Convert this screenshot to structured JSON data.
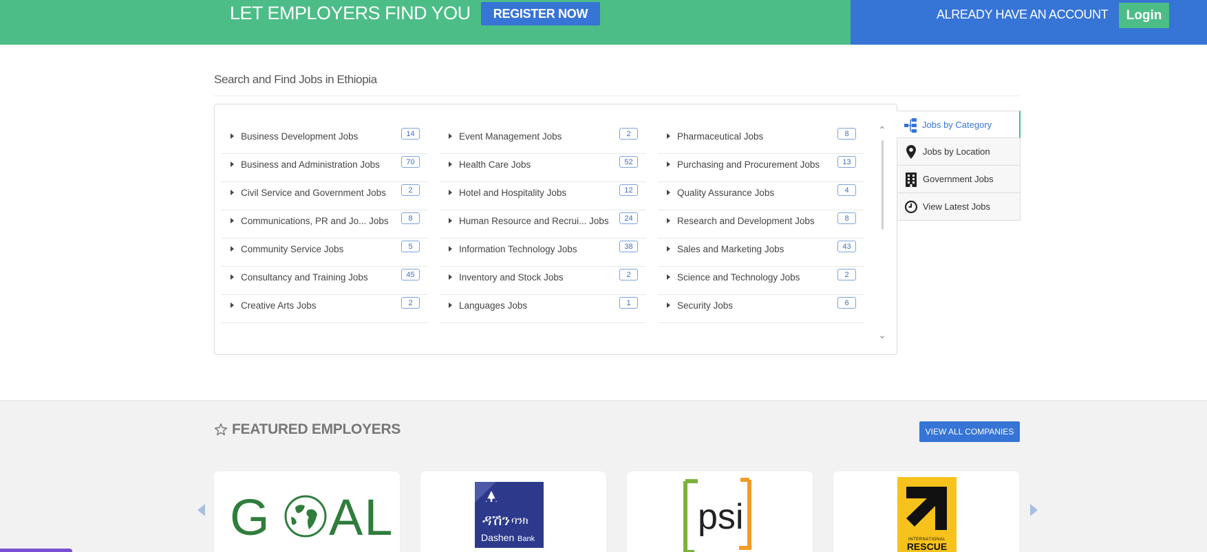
{
  "banner": {
    "headline": "LET EMPLOYERS FIND YOU",
    "register_label": "REGISTER NOW",
    "account_text": "ALREADY HAVE AN ACCOUNT",
    "login_label": "Login",
    "colors": {
      "green": "#4cbd87",
      "blue": "#3674d6"
    }
  },
  "search": {
    "title": "Search and Find Jobs in Ethiopia",
    "columns": [
      [
        {
          "label": "Business Development Jobs",
          "count": "14"
        },
        {
          "label": "Business and Administration Jobs",
          "count": "70"
        },
        {
          "label": "Civil Service and Government Jobs",
          "count": "2"
        },
        {
          "label": "Communications, PR and Jo... Jobs",
          "count": "8"
        },
        {
          "label": "Community Service Jobs",
          "count": "5"
        },
        {
          "label": "Consultancy and Training Jobs",
          "count": "45"
        },
        {
          "label": "Creative Arts Jobs",
          "count": "2"
        }
      ],
      [
        {
          "label": "Event Management Jobs",
          "count": "2"
        },
        {
          "label": "Health Care Jobs",
          "count": "52"
        },
        {
          "label": "Hotel and Hospitality Jobs",
          "count": "12"
        },
        {
          "label": "Human Resource and Recrui... Jobs",
          "count": "24"
        },
        {
          "label": "Information Technology Jobs",
          "count": "38"
        },
        {
          "label": "Inventory and Stock Jobs",
          "count": "2"
        },
        {
          "label": "Languages Jobs",
          "count": "1"
        }
      ],
      [
        {
          "label": "Pharmaceutical Jobs",
          "count": "8"
        },
        {
          "label": "Purchasing and Procurement Jobs",
          "count": "13"
        },
        {
          "label": "Quality Assurance Jobs",
          "count": "4"
        },
        {
          "label": "Research and Development Jobs",
          "count": "8"
        },
        {
          "label": "Sales and Marketing Jobs",
          "count": "43"
        },
        {
          "label": "Science and Technology Jobs",
          "count": "2"
        },
        {
          "label": "Security Jobs",
          "count": "6"
        }
      ]
    ]
  },
  "side_tabs": [
    {
      "label": "Jobs by Category",
      "icon": "category-tree-icon",
      "active": true
    },
    {
      "label": "Jobs by Location",
      "icon": "location-pin-icon",
      "active": false
    },
    {
      "label": "Government Jobs",
      "icon": "building-icon",
      "active": false
    },
    {
      "label": "View Latest Jobs",
      "icon": "clock-icon",
      "active": false
    }
  ],
  "featured": {
    "title": "FEATURED EMPLOYERS",
    "view_all_label": "VIEW ALL COMPANIES",
    "employers": [
      {
        "logo_text": "GOAL",
        "icon": "goal-logo"
      },
      {
        "logo_text": "Dashen Bank",
        "icon": "dashen-bank-logo"
      },
      {
        "logo_text": "psi",
        "icon": "psi-logo"
      },
      {
        "logo_text": "INTERNATIONAL RESCUE COMMITTEE",
        "icon": "irc-logo"
      }
    ]
  }
}
